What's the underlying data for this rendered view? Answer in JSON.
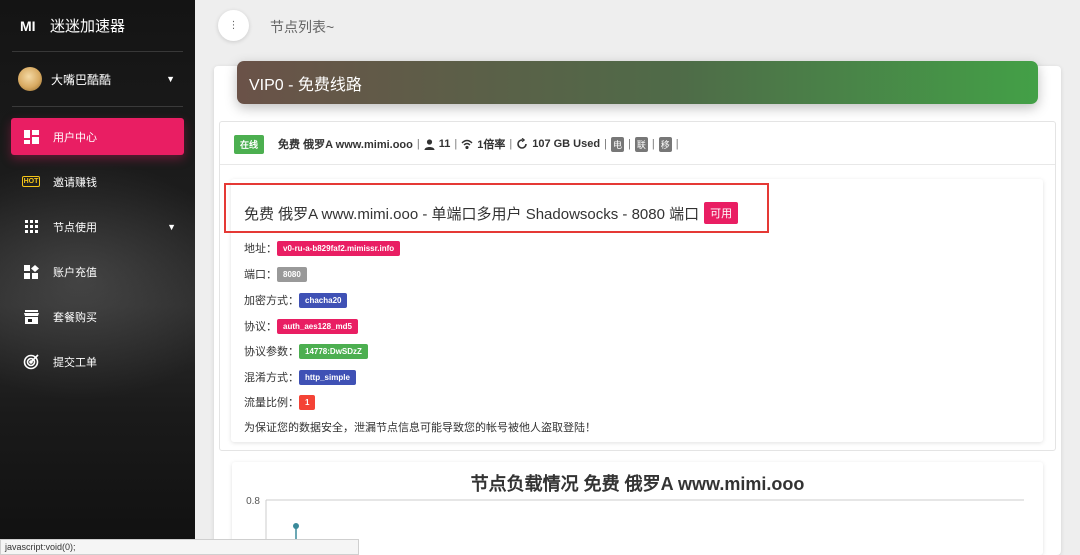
{
  "brand": {
    "mark": "MI",
    "name": "迷迷加速器"
  },
  "user": {
    "name": "大嘴巴酷酷"
  },
  "nav": [
    {
      "label": "用户中心",
      "icon": "dashboard-icon"
    },
    {
      "label": "邀请赚钱",
      "icon": "hot-icon",
      "hot_text": "HOT"
    },
    {
      "label": "节点使用",
      "icon": "grid-icon"
    },
    {
      "label": "账户充值",
      "icon": "recharge-icon"
    },
    {
      "label": "套餐购买",
      "icon": "store-icon"
    },
    {
      "label": "提交工单",
      "icon": "target-icon"
    }
  ],
  "topbar": {
    "title": "节点列表~"
  },
  "card": {
    "header": "VIP0 - 免费线路"
  },
  "node_info": {
    "status": "在线",
    "name": "免费 俄罗A www.mimi.ooo",
    "users": "11",
    "rate": "1倍率",
    "traffic": "107 GB Used",
    "carriers": [
      "电",
      "联",
      "移"
    ]
  },
  "node": {
    "title": "免费 俄罗A www.mimi.ooo - 单端口多用户 Shadowsocks - 8080 端口",
    "available": "可用",
    "fields": [
      {
        "label": "地址：",
        "value": "v0-ru-a-b829faf2.mimissr.info",
        "color": "#e91e63"
      },
      {
        "label": "端口：",
        "value": "8080",
        "color": "#999999"
      },
      {
        "label": "加密方式：",
        "value": "chacha20",
        "color": "#3f51b5"
      },
      {
        "label": "协议：",
        "value": "auth_aes128_md5",
        "color": "#e91e63"
      },
      {
        "label": "协议参数：",
        "value": "14778:DwSDzZ",
        "color": "#4caf50"
      },
      {
        "label": "混淆方式：",
        "value": "http_simple",
        "color": "#3f51b5"
      },
      {
        "label": "流量比例：",
        "value": "1",
        "color": "#f44336"
      }
    ],
    "warning": "为保证您的数据安全，泄漏节点信息可能导致您的帐号被他人盗取登陆！"
  },
  "chart_data": {
    "type": "line",
    "title": "节点负载情况 免费 俄罗A www.mimi.ooo",
    "y_ticks": [
      "0.8"
    ],
    "ylim": [
      0.6,
      0.8
    ],
    "points": [
      0.72
    ]
  },
  "status_bar": {
    "url": "javascript:void(0);"
  }
}
